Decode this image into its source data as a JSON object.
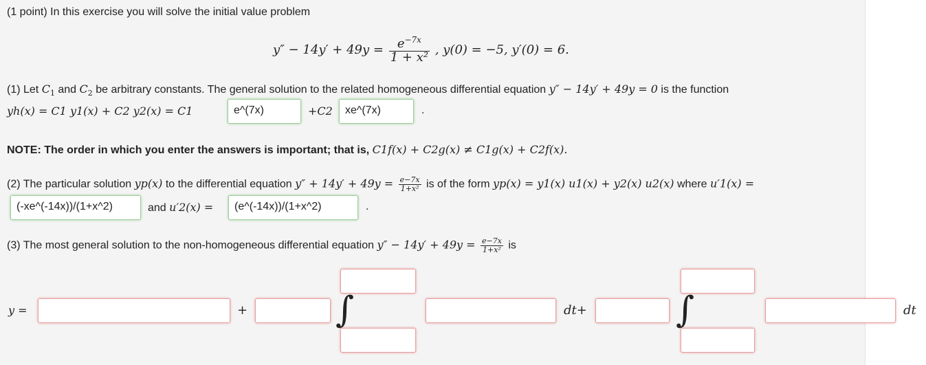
{
  "header": {
    "text": "(1 point) In this exercise you will solve the initial value problem"
  },
  "ivp": {
    "lhs": "y″ − 14y′ + 49y =",
    "num": "e",
    "num_exp": "−7x",
    "den": "1 + x²",
    "conditions": ", y(0) = −5, y′(0) = 6."
  },
  "part1": {
    "line1_a": "(1) Let ",
    "c1": "C",
    "c1_sub": "1",
    "and": " and ",
    "c2": "C",
    "c2_sub": "2",
    "line1_b": " be arbitrary constants. The general solution to the related homogeneous differential equation ",
    "eq": "y″ − 14y′ + 49y = 0",
    "line1_c": " is the function",
    "line2_a": "yh(x) = C1 y1(x) + C2 y2(x) = C1",
    "plus_c2": "+C2",
    "answer1": "e^(7x)",
    "answer2": "xe^(7x)",
    "period": "."
  },
  "note": {
    "label": "NOTE:",
    "text": " The order in which you enter the answers is important; that is, ",
    "math": "C1f(x) + C2g(x) ≠ C1g(x) + C2f(x)."
  },
  "part2": {
    "line1_a": "(2) The particular solution ",
    "yp": "yp(x)",
    "line1_b": " to the differential equation ",
    "eq": "y″ + 14y′ + 49y =",
    "frac_num": "e−7x",
    "frac_den": "1+x²",
    "line1_c": " is of the form ",
    "form": "yp(x) = y1(x) u1(x) + y2(x) u2(x)",
    "line1_d": " where ",
    "u1": "u′1(x) =",
    "answer1": "(-xe^(-14x))/(1+x^2)",
    "and": "and ",
    "u2": "u′2(x) =",
    "answer2": "(e^(-14x))/(1+x^2)",
    "period": "."
  },
  "part3": {
    "line_a": "(3) The most general solution to the non-homogeneous differential equation ",
    "eq": "y″ − 14y′ + 49y =",
    "frac_num": "e−7x",
    "frac_den": "1+x²",
    "line_b": " is",
    "y_eq": "y =",
    "plus": "+",
    "dt_plus": "dt+",
    "dt": "dt",
    "integral": "∫"
  },
  "colors": {
    "panel": "#f4f4f4",
    "correct_border": "#9ccf9c",
    "empty_border": "#e7a0a0"
  }
}
